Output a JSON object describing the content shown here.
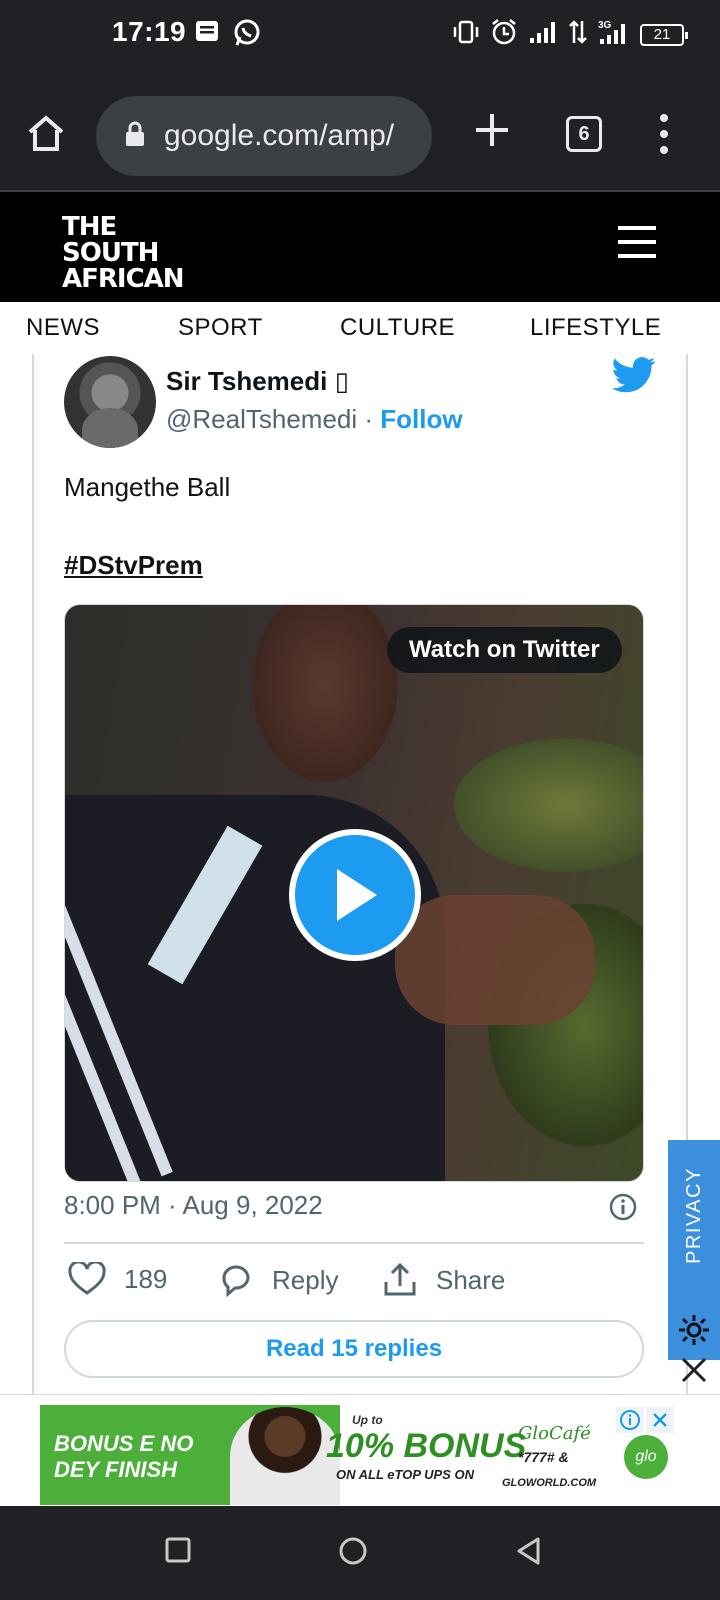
{
  "status_bar": {
    "time": "17:19",
    "icons_left": [
      "message-icon",
      "whatsapp-icon"
    ],
    "icons_right": [
      "vibrate-icon",
      "alarm-icon",
      "signal-icon",
      "data-arrows-icon",
      "signal-3g-icon"
    ],
    "network": "3G",
    "battery": "21"
  },
  "browser": {
    "url": "google.com/amp/",
    "tab_count": "6"
  },
  "site": {
    "logo_lines": [
      "THE",
      "SOUTH",
      "AFRICAN"
    ],
    "nav": [
      "NEWS",
      "SPORT",
      "CULTURE",
      "LIFESTYLE"
    ]
  },
  "tweet": {
    "name": "Sir Tshemedi ▯",
    "handle": "@RealTshemedi",
    "separator": "·",
    "follow": "Follow",
    "text": "Mangethe Ball",
    "hashtag": "#DStvPrem",
    "watch_label": "Watch on Twitter",
    "timestamp": "8:00 PM · Aug 9, 2022",
    "likes": "189",
    "reply": "Reply",
    "share": "Share",
    "read_replies": "Read 15 replies"
  },
  "privacy": {
    "label": "PRIVACY"
  },
  "ad": {
    "slogan_line1": "BONUS E NO",
    "slogan_line2": "DEY FINISH",
    "upto": "Up to",
    "headline": "10% BONUS",
    "subline": "ON ALL eTOP UPS ON",
    "brand": "GloCafé",
    "code": "*777# &",
    "site": "GLOWORLD.COM",
    "logo": "glo"
  },
  "colors": {
    "twitter_blue": "#1d9bf0",
    "chrome_dark": "#202124",
    "privacy_blue": "#3b8fdc",
    "glo_green": "#4caf3a"
  }
}
